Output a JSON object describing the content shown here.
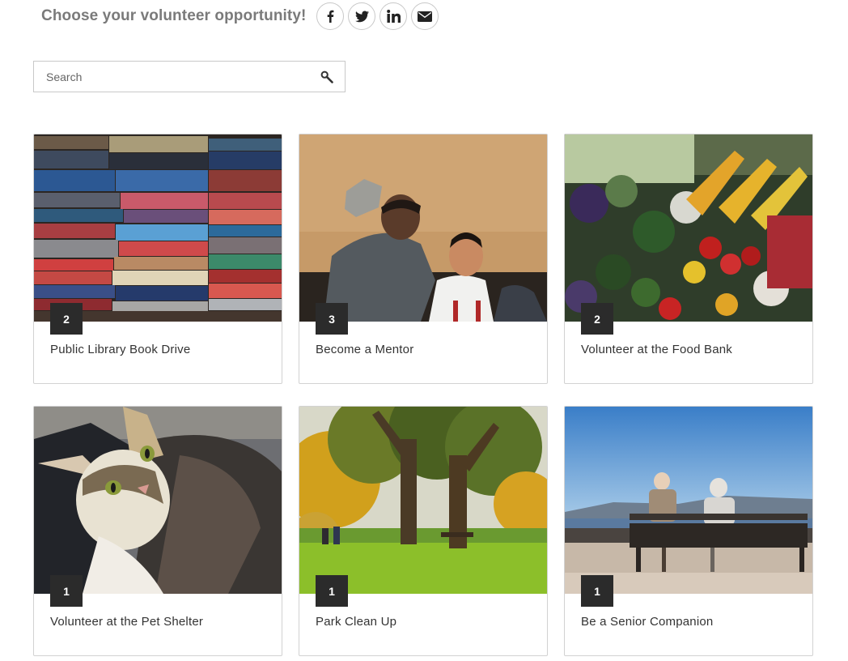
{
  "header": {
    "title": "Choose your volunteer opportunity!",
    "share": [
      {
        "name": "facebook-icon"
      },
      {
        "name": "twitter-icon"
      },
      {
        "name": "linkedin-icon"
      },
      {
        "name": "email-icon"
      }
    ]
  },
  "search": {
    "placeholder": "Search",
    "icon": "search-icon"
  },
  "opportunities": [
    {
      "title": "Public Library Book Drive",
      "count": "2"
    },
    {
      "title": "Become a Mentor",
      "count": "3"
    },
    {
      "title": "Volunteer at the Food Bank",
      "count": "2"
    },
    {
      "title": "Volunteer at the Pet Shelter",
      "count": "1"
    },
    {
      "title": "Park Clean Up",
      "count": "1"
    },
    {
      "title": "Be a Senior Companion",
      "count": "1"
    }
  ]
}
